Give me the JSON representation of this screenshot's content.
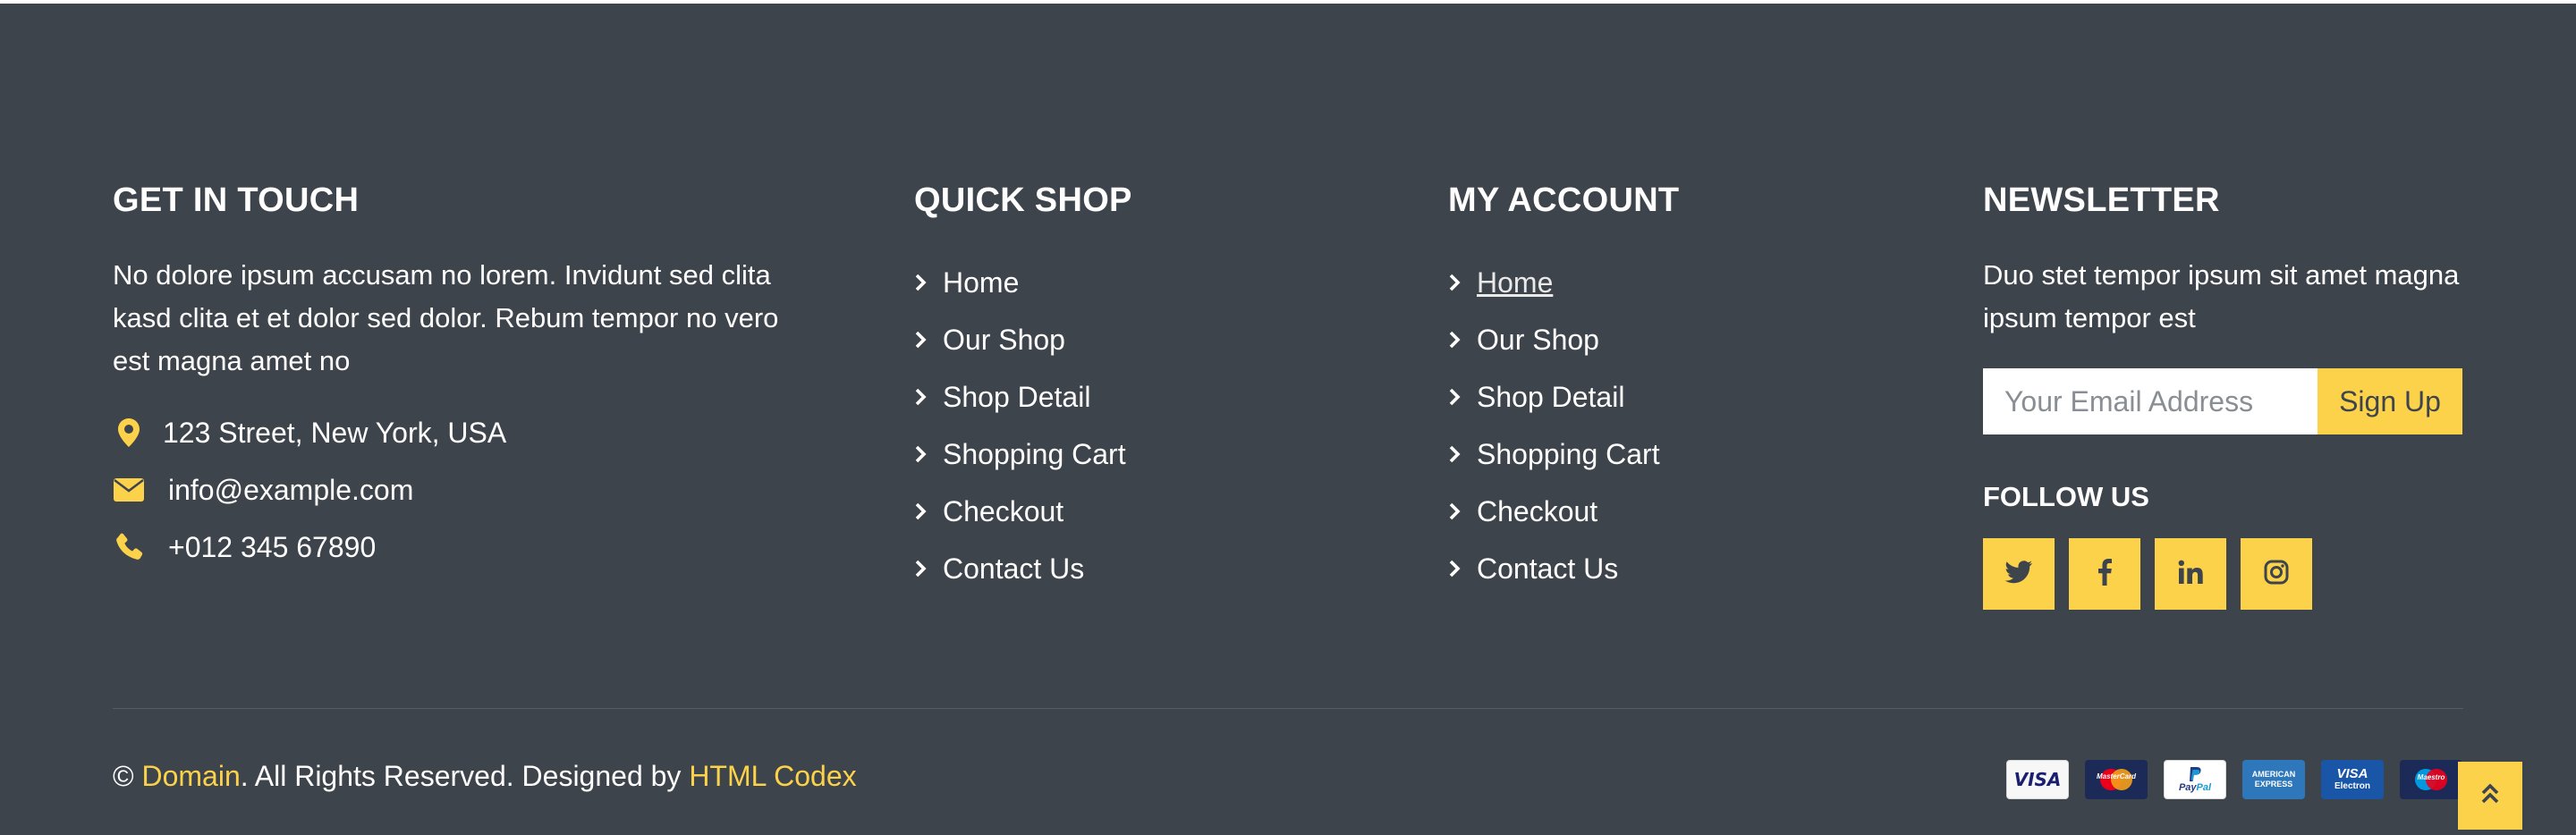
{
  "colors": {
    "background": "#3e444b",
    "accent": "#fcd24b",
    "text": "#ffffff"
  },
  "contact": {
    "title": "GET IN TOUCH",
    "intro": "No dolore ipsum accusam no lorem. Invidunt sed clita kasd clita et et dolor sed dolor. Rebum tempor no vero est magna amet no",
    "address": "123 Street, New York, USA",
    "email": "info@example.com",
    "phone": "+012 345 67890",
    "icons": [
      "map-marker-icon",
      "envelope-icon",
      "phone-icon"
    ]
  },
  "quick_shop": {
    "title": "QUICK SHOP",
    "links": [
      "Home",
      "Our Shop",
      "Shop Detail",
      "Shopping Cart",
      "Checkout",
      "Contact Us"
    ]
  },
  "my_account": {
    "title": "MY ACCOUNT",
    "links": [
      "Home",
      "Our Shop",
      "Shop Detail",
      "Shopping Cart",
      "Checkout",
      "Contact Us"
    ]
  },
  "newsletter": {
    "title": "NEWSLETTER",
    "intro": "Duo stet tempor ipsum sit amet magna ipsum tempor est",
    "placeholder": "Your Email Address",
    "button": "Sign Up",
    "follow_title": "FOLLOW US",
    "social_icons": [
      "twitter-icon",
      "facebook-icon",
      "linkedin-icon",
      "instagram-icon"
    ]
  },
  "copyright": {
    "prefix": "©",
    "site": "Domain",
    "middle": ". All Rights Reserved. Designed by",
    "designer": "HTML Codex"
  },
  "payments": {
    "visa": "VISA",
    "mastercard": "MasterCard",
    "paypal_pay": "Pay",
    "paypal_pal": "Pal",
    "amex": "AMERICAN EXPRESS",
    "visa_electron_top": "VISA",
    "visa_electron_bottom": "Electron",
    "maestro": "Maestro"
  }
}
